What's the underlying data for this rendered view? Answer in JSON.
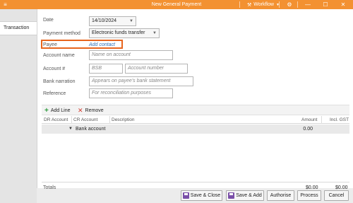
{
  "window": {
    "title": "New General Payment",
    "workflow_label": "Workflow",
    "menu_icon": "menu-icon",
    "minimize_glyph": "—",
    "restore_glyph": "☐",
    "close_glyph": "✕"
  },
  "tabs": [
    {
      "label": "Transaction",
      "active": true
    }
  ],
  "form": {
    "date": {
      "label": "Date",
      "value": "14/10/2024"
    },
    "payment_method": {
      "label": "Payment method",
      "value": "Electronic funds transfer"
    },
    "payee": {
      "label": "Payee",
      "link": "Add contact"
    },
    "account_name": {
      "label": "Account name",
      "placeholder": "Name on account"
    },
    "account_number": {
      "label": "Account #",
      "bsb_placeholder": "BSB",
      "number_placeholder": "Account number"
    },
    "bank_narration": {
      "label": "Bank narration",
      "placeholder": "Appears on payee's bank statement"
    },
    "reference": {
      "label": "Reference",
      "placeholder": "For reconciliation purposes"
    }
  },
  "toolbar": {
    "add_line": "Add Line",
    "remove": "Remove"
  },
  "table": {
    "columns": [
      "DR Account",
      "CR Account",
      "Description",
      "Amount",
      "Incl. GST"
    ],
    "group": {
      "label": "Bank account",
      "amount": "0.00"
    }
  },
  "totals": {
    "label": "Totals",
    "amount": "$0.00",
    "incl_gst": "$0.00"
  },
  "buttons": {
    "save_close": "Save & Close",
    "save_add": "Save & Add",
    "authorise": "Authorise",
    "process": "Process",
    "cancel": "Cancel"
  },
  "colors": {
    "titlebar": "#f39131",
    "highlight_border": "#e8651d",
    "link": "#2a6db5"
  }
}
